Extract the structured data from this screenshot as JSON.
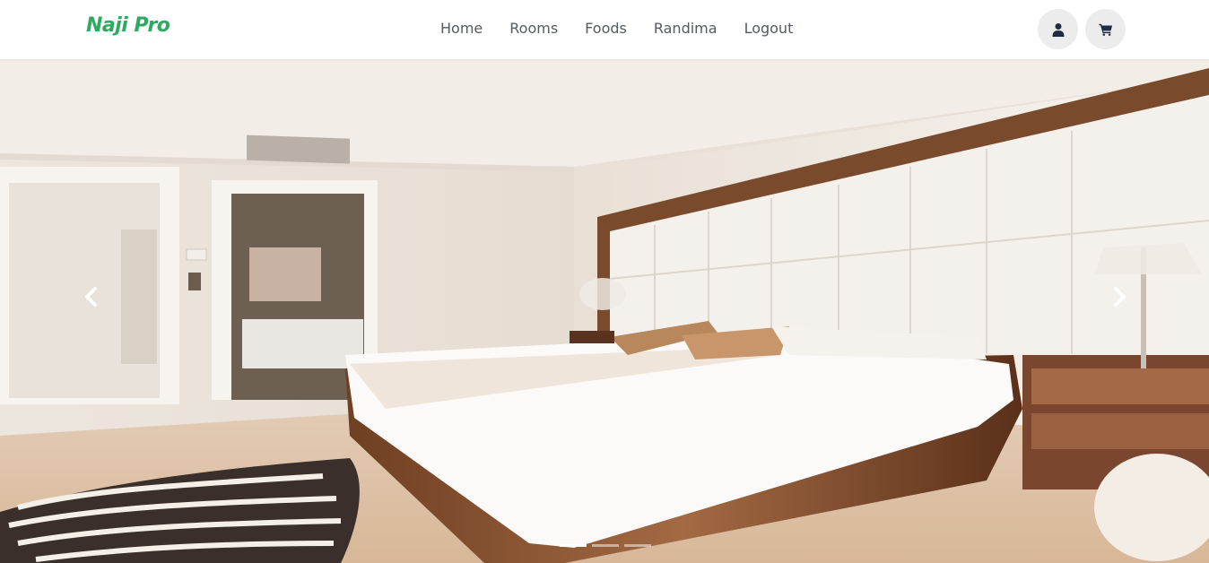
{
  "brand": {
    "name": "Naji Pro",
    "color": "#2daa62"
  },
  "nav": {
    "items": [
      {
        "label": "Home"
      },
      {
        "label": "Rooms"
      },
      {
        "label": "Foods"
      },
      {
        "label": "Randima"
      },
      {
        "label": "Logout"
      }
    ]
  },
  "actions": {
    "user_icon": "user-icon",
    "cart_icon": "shopping-cart-icon"
  },
  "carousel": {
    "slide_image": "bedroom-interior-photo",
    "prev_icon": "chevron-left-icon",
    "next_icon": "chevron-right-icon",
    "slide_count": 3,
    "active_slide": 1
  }
}
